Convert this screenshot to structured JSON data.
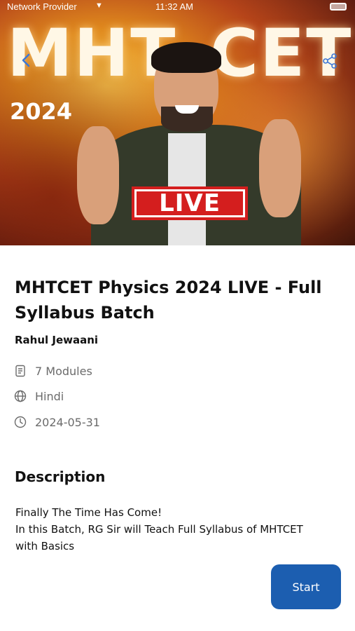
{
  "status_bar": {
    "provider": "Network Provider",
    "time": "11:32 AM"
  },
  "hero": {
    "title_left": "MHT",
    "title_right": "CET",
    "year": "2024",
    "badge": "LIVE"
  },
  "course": {
    "title": "MHTCET Physics 2024 LIVE - Full Syllabus Batch",
    "instructor": "Rahul Jewaani",
    "modules": "7 Modules",
    "language": "Hindi",
    "date": "2024-05-31"
  },
  "description": {
    "heading": "Description",
    "lines": [
      "Finally The Time Has Come!",
      "In this Batch, RG Sir will Teach Full Syllabus of MHTCET",
      "with Basics"
    ]
  },
  "actions": {
    "start_label": "Start"
  },
  "colors": {
    "accent": "#1c5eb0",
    "back_icon": "#3a77d8",
    "live_red": "#d41e1e"
  },
  "icons": {
    "back": "chevron-left-icon",
    "share": "share-icon",
    "modules": "document-icon",
    "language": "globe-icon",
    "date": "clock-icon"
  }
}
